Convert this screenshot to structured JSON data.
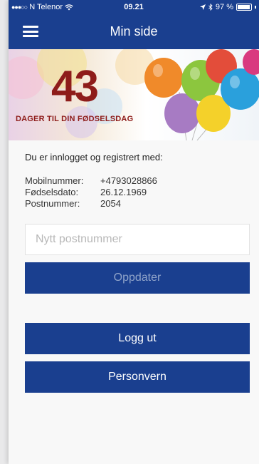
{
  "status_bar": {
    "signal": "●●●○○",
    "carrier": "N Telenor",
    "time": "09.21",
    "battery": "97 %"
  },
  "header": {
    "title": "Min side"
  },
  "banner": {
    "days_count": "43",
    "label": "DAGER TIL DIN FØDSELSDAG"
  },
  "account": {
    "intro": "Du er innlogget og registrert med:",
    "fields": [
      {
        "label": "Mobilnummer:",
        "value": "+4793028866"
      },
      {
        "label": "Fødselsdato:",
        "value": "26.12.1969"
      },
      {
        "label": "Postnummer:",
        "value": "2054"
      }
    ]
  },
  "form": {
    "postnr_placeholder": "Nytt postnummer",
    "update_label": "Oppdater"
  },
  "actions": {
    "logout_label": "Logg ut",
    "privacy_label": "Personvern"
  },
  "colors": {
    "brand": "#1a3f8f",
    "accent": "#8e1c1a"
  }
}
